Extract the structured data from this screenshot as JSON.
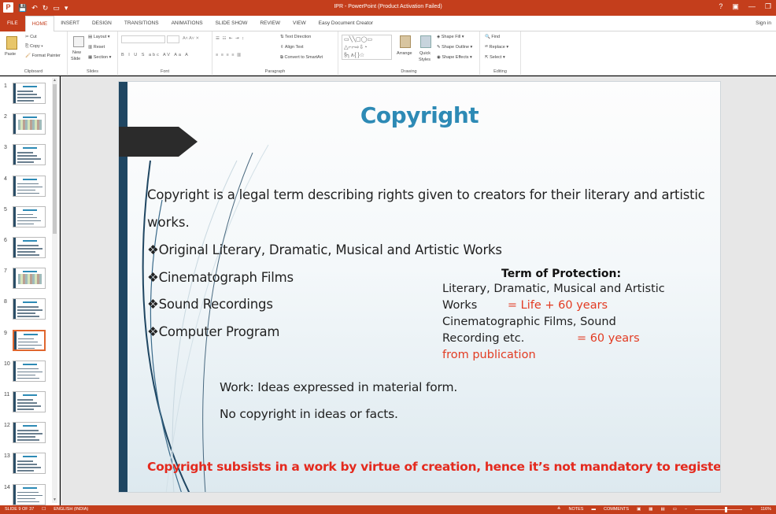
{
  "window": {
    "title": "IPR - PowerPoint (Product Activation Failed)",
    "app_letter": "P",
    "controls": [
      "?",
      "▣",
      "—",
      "❐"
    ]
  },
  "tabs": [
    "FILE",
    "HOME",
    "INSERT",
    "DESIGN",
    "TRANSITIONS",
    "ANIMATIONS",
    "SLIDE SHOW",
    "REVIEW",
    "VIEW",
    "Easy Document Creator"
  ],
  "sign_in": "Sign in",
  "ribbon": {
    "clipboard": {
      "paste": "Paste",
      "cut": "Cut",
      "copy": "Copy",
      "format_painter": "Format Painter",
      "label": "Clipboard"
    },
    "slides": {
      "new_slide": "New",
      "new_slide2": "Slide",
      "layout": "Layout",
      "reset": "Reset",
      "section": "Section",
      "label": "Slides"
    },
    "font": {
      "label": "Font"
    },
    "paragraph": {
      "text_direction": "Text Direction",
      "align_text": "Align Text",
      "convert_smartart": "Convert to SmartArt",
      "label": "Paragraph"
    },
    "drawing": {
      "arrange": "Arrange",
      "quick": "Quick",
      "styles": "Styles",
      "shape_fill": "Shape Fill",
      "shape_outline": "Shape Outline",
      "shape_effects": "Shape Effects",
      "label": "Drawing"
    },
    "editing": {
      "find": "Find",
      "replace": "Replace",
      "select": "Select",
      "label": "Editing"
    }
  },
  "thumbnails": [
    {
      "num": "1"
    },
    {
      "num": "2"
    },
    {
      "num": "3"
    },
    {
      "num": "4"
    },
    {
      "num": "5"
    },
    {
      "num": "6"
    },
    {
      "num": "7"
    },
    {
      "num": "8"
    },
    {
      "num": "9"
    },
    {
      "num": "10"
    },
    {
      "num": "11"
    },
    {
      "num": "12"
    },
    {
      "num": "13"
    },
    {
      "num": "14"
    }
  ],
  "selected_slide": 9,
  "slide": {
    "title": "Copyright",
    "intro_line1": "Copyright is a legal term describing rights given to creators for their literary and artistic",
    "intro_line2": "works.",
    "bullets": [
      "❖Original Literary, Dramatic, Musical and Artistic Works",
      "❖Cinematograph Films",
      "❖Sound Recordings",
      "❖Computer Program"
    ],
    "term_heading": "Term of Protection:",
    "term_line1": "Literary,  Dramatic,  Musical  and  Artistic",
    "term_line2a": "Works",
    "term_line2b": "=     Life + 60 years",
    "term_line3": "Cinematographic           Films,           Sound",
    "term_line4a": "Recording etc.",
    "term_line4b": "=     60     years",
    "term_line5": "from publication",
    "work_line1": "Work: Ideas expressed in material form.",
    "work_line2": "No copyright in ideas or facts.",
    "footer": "Copyright subsists in a work by virtue of creation, hence it’s not mandatory to register."
  },
  "status": {
    "slide_counter": "SLIDE 9 OF 37",
    "language": "ENGLISH (INDIA)",
    "notes": "NOTES",
    "comments": "COMMENTS",
    "zoom": "116%"
  },
  "colors": {
    "accent": "#c43e1c",
    "slide_title": "#2d8ab5",
    "slide_bar": "#1f4662",
    "red_text": "#e42a1e"
  }
}
